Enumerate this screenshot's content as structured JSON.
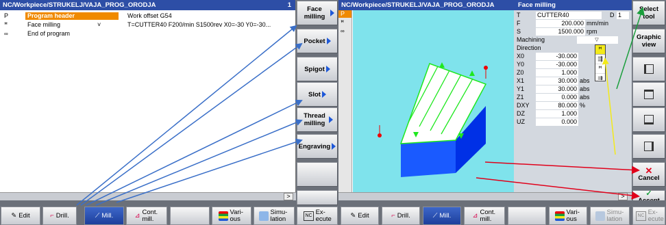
{
  "left_pane": {
    "title": "NC/Workpiece/STRUKELJ/VAJA_PROG_ORODJA",
    "channel": "1",
    "rows": [
      {
        "icon": "P",
        "name": "Program header",
        "detail": "Work offset G54",
        "selected": true
      },
      {
        "icon": "ꟸ",
        "name": "Face milling",
        "mark": "˅",
        "detail": "T=CUTTER40 F200/min S1500rev X0=-30 Y0=-30..."
      },
      {
        "icon": "∞",
        "name": "End of program",
        "detail": ""
      }
    ],
    "scroll_label": ">"
  },
  "mid_softkeys": [
    {
      "label": "Face milling",
      "arrow": true
    },
    {
      "label": "Pocket",
      "arrow": true
    },
    {
      "label": "Spigot",
      "arrow": true
    },
    {
      "label": "Slot",
      "arrow": true
    },
    {
      "label": "Thread milling",
      "arrow": true
    },
    {
      "label": "Engraving",
      "arrow": true
    },
    {
      "label": "",
      "arrow": false
    },
    {
      "label": "",
      "arrow": false
    }
  ],
  "right_pane": {
    "title": "NC/Workpiece/STRUKELJ/VAJA_PROG_ORODJA",
    "form_title": "Face milling",
    "tree_letter": "P",
    "params": [
      {
        "name": "T",
        "value": "CUTTER40",
        "extra": "D",
        "extra_val": "1"
      },
      {
        "name": "F",
        "value": "200.000",
        "unit": "mm/min"
      },
      {
        "name": "S",
        "value": "1500.000",
        "unit": "rpm"
      },
      {
        "name": "Machining",
        "value": "▽"
      },
      {
        "name": "Direction",
        "value": ""
      },
      {
        "name": "X0",
        "value": "-30.000",
        "unit": ""
      },
      {
        "name": "Y0",
        "value": "-30.000",
        "unit": ""
      },
      {
        "name": "Z0",
        "value": "1.000",
        "unit": ""
      },
      {
        "name": "X1",
        "value": "30.000",
        "unit": "abs"
      },
      {
        "name": "Y1",
        "value": "30.000",
        "unit": "abs"
      },
      {
        "name": "Z1",
        "value": "0.000",
        "unit": "abs"
      },
      {
        "name": "DXY",
        "value": "80.000",
        "unit": "%"
      },
      {
        "name": "DZ",
        "value": "1.000",
        "unit": ""
      },
      {
        "name": "UZ",
        "value": "0.000",
        "unit": ""
      }
    ],
    "scroll_label": ">"
  },
  "right_softkeys": [
    {
      "label": "Select tool"
    },
    {
      "label": "Graphic view"
    },
    {
      "label": ""
    },
    {
      "label": ""
    },
    {
      "label": ""
    },
    {
      "label": ""
    },
    {
      "label": "Cancel"
    },
    {
      "label": "Accept"
    }
  ],
  "bottom_left": [
    {
      "label": "Edit"
    },
    {
      "label": "Drill."
    },
    {
      "label": "Mill.",
      "active": true
    },
    {
      "label": "Cont. mill."
    },
    {
      "label": ""
    },
    {
      "label": "Vari- ous"
    },
    {
      "label": "Simu- lation"
    },
    {
      "label": "Ex- ecute"
    }
  ],
  "bottom_right": [
    {
      "label": "Edit"
    },
    {
      "label": "Drill."
    },
    {
      "label": "Mill.",
      "active": true
    },
    {
      "label": "Cont. mill."
    },
    {
      "label": ""
    },
    {
      "label": "Vari- ous"
    },
    {
      "label": "Simu- lation"
    },
    {
      "label": "Ex- ecute"
    }
  ],
  "colors": {
    "title_bar": "#2d4ea6",
    "selection": "#f08a00",
    "graphic_bg": "#7fe3ec",
    "annotation_blue": "#3a6fc8",
    "annotation_red": "#e0001a",
    "annotation_green": "#1a9e3c",
    "annotation_yellow": "#f3ea1a"
  }
}
